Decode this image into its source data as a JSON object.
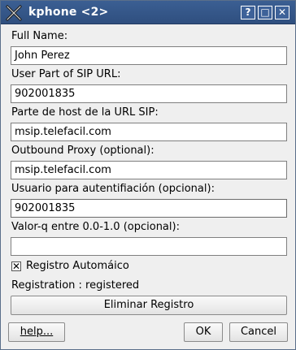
{
  "window": {
    "title": "kphone <2>"
  },
  "titlebar_buttons": {
    "help": "?",
    "maximize": "□",
    "close": "✕"
  },
  "form": {
    "full_name": {
      "label": "Full Name:",
      "value": "John Perez"
    },
    "user_part": {
      "label": "User Part of SIP URL:",
      "value": "902001835"
    },
    "host_part": {
      "label": "Parte de host de la URL SIP:",
      "value": "msip.telefacil.com"
    },
    "outbound_proxy": {
      "label": "Outbound Proxy (optional):",
      "value": "msip.telefacil.com"
    },
    "auth_user": {
      "label": "Usuario para autentifiación (opcional):",
      "value": "902001835"
    },
    "q_value": {
      "label": "Valor-q entre 0.0-1.0 (opcional):",
      "value": ""
    }
  },
  "auto_register": {
    "label": "Registro Automáico",
    "checked": true,
    "mark": "✕"
  },
  "status": {
    "text": "Registration : registered"
  },
  "buttons": {
    "unregister": "Eliminar Registro",
    "help": "help...",
    "ok": "OK",
    "cancel": "Cancel"
  },
  "icons": {
    "app": "kphone-x-icon"
  }
}
